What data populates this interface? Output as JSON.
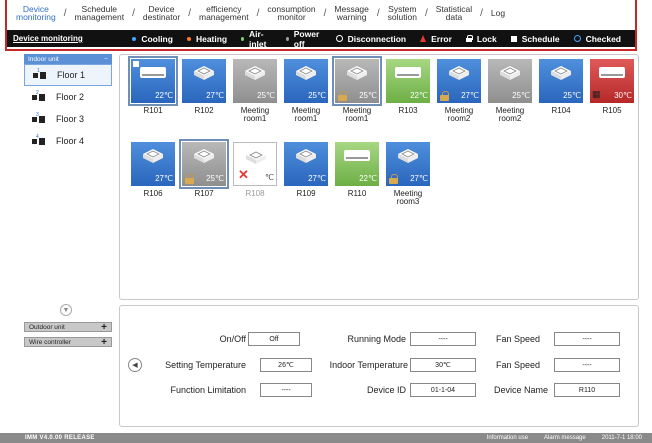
{
  "nav": {
    "items": [
      {
        "label": "Device\nmonitoring",
        "active": true
      },
      {
        "label": "Schedule\nmanagement",
        "active": false
      },
      {
        "label": "Device\ndestinator",
        "active": false
      },
      {
        "label": "efficiency\nmanagement",
        "active": false
      },
      {
        "label": "consumption\nmonitor",
        "active": false
      },
      {
        "label": "Message\nwarning",
        "active": false
      },
      {
        "label": "System\nsolution",
        "active": false
      },
      {
        "label": "Statistical\ndata",
        "active": false
      },
      {
        "label": "Log",
        "active": false
      }
    ]
  },
  "status_bar": {
    "title": "Device monitoring",
    "legend": [
      {
        "label": "Cooling",
        "marker": "dot",
        "color": "#4aa3ff"
      },
      {
        "label": "Heating",
        "marker": "dot",
        "color": "#ff7a1a"
      },
      {
        "label": "Air-inlet",
        "marker": "dot",
        "color": "#7ad36b"
      },
      {
        "label": "Power off",
        "marker": "dot",
        "color": "#9e9e9e"
      },
      {
        "label": "Disconnection",
        "marker": "ring",
        "color": "#ffffff"
      },
      {
        "label": "Error",
        "marker": "error",
        "color": "#e53935"
      },
      {
        "label": "Lock",
        "marker": "lock",
        "color": "#ffffff"
      },
      {
        "label": "Schedule",
        "marker": "square",
        "color": "#ffffff"
      },
      {
        "label": "Checked",
        "marker": "ring-blue",
        "color": "#4aa3ff"
      }
    ]
  },
  "sidebar": {
    "header": "Indoor unit",
    "header_action": "−",
    "floors": [
      {
        "label": "Floor 1",
        "num": "1",
        "active": true
      },
      {
        "label": "Floor 2",
        "num": "2",
        "active": false
      },
      {
        "label": "Floor 3",
        "num": "3",
        "active": false
      },
      {
        "label": "Floor 4",
        "num": "4",
        "active": false
      }
    ],
    "scroll_icon": "▼",
    "outdoor_unit": "Outdoor unit",
    "wire_controller": "Wire controller",
    "expand_label": "+"
  },
  "units": [
    {
      "name": "R101",
      "temp": "22℃",
      "color": "blue",
      "type": "wall",
      "lock": false,
      "schedule": true,
      "selected": true,
      "error": false
    },
    {
      "name": "R102",
      "temp": "27℃",
      "color": "blue",
      "type": "cassette",
      "lock": false,
      "schedule": false,
      "selected": false,
      "error": false
    },
    {
      "name": "Meeting\nroom1",
      "temp": "25℃",
      "color": "gray",
      "type": "cassette",
      "lock": false,
      "schedule": false,
      "selected": false,
      "error": false
    },
    {
      "name": "Meeting\nroom1",
      "temp": "25℃",
      "color": "blue",
      "type": "cassette",
      "lock": false,
      "schedule": false,
      "selected": false,
      "error": false
    },
    {
      "name": "Meeting\nroom1",
      "temp": "25℃",
      "color": "gray",
      "type": "cassette",
      "lock": true,
      "schedule": false,
      "selected": true,
      "error": false
    },
    {
      "name": "R103",
      "temp": "22℃",
      "color": "green",
      "type": "wall",
      "lock": false,
      "schedule": false,
      "selected": false,
      "error": false
    },
    {
      "name": "Meeting\nroom2",
      "temp": "27℃",
      "color": "blue",
      "type": "cassette",
      "lock": true,
      "schedule": false,
      "selected": false,
      "error": false
    },
    {
      "name": "Meeting\nroom2",
      "temp": "25℃",
      "color": "gray",
      "type": "cassette",
      "lock": false,
      "schedule": false,
      "selected": false,
      "error": false
    },
    {
      "name": "R104",
      "temp": "25℃",
      "color": "blue",
      "type": "cassette",
      "lock": false,
      "schedule": false,
      "selected": false,
      "error": false
    },
    {
      "name": "R105",
      "temp": "30℃",
      "color": "red",
      "type": "wall",
      "lock": false,
      "schedule": false,
      "selected": false,
      "error": false,
      "building": true
    },
    {
      "name": "R106",
      "temp": "27℃",
      "color": "blue",
      "type": "cassette",
      "lock": false,
      "schedule": false,
      "selected": false,
      "error": false
    },
    {
      "name": "R107",
      "temp": "25℃",
      "color": "gray",
      "type": "cassette",
      "lock": true,
      "schedule": false,
      "selected": true,
      "error": false
    },
    {
      "name": "R108",
      "temp": "℃",
      "color": "off",
      "type": "cassette",
      "lock": false,
      "schedule": false,
      "selected": false,
      "error": true
    },
    {
      "name": "R109",
      "temp": "27℃",
      "color": "blue",
      "type": "cassette",
      "lock": false,
      "schedule": false,
      "selected": false,
      "error": false
    },
    {
      "name": "R110",
      "temp": "22℃",
      "color": "green",
      "type": "wall",
      "lock": false,
      "schedule": false,
      "selected": false,
      "error": false
    },
    {
      "name": "Meeting\nroom3",
      "temp": "27℃",
      "color": "blue",
      "type": "cassette",
      "lock": true,
      "schedule": false,
      "selected": false,
      "error": false
    }
  ],
  "details": {
    "nav_icon": "◀",
    "fields": {
      "on_off": {
        "label": "On/Off",
        "value": "Off"
      },
      "running_mode": {
        "label": "Running Mode",
        "value": "----"
      },
      "fan_speed_1": {
        "label": "Fan Speed",
        "value": "----"
      },
      "setting_temp": {
        "label": "Setting Temperature",
        "value": "26℃"
      },
      "indoor_temp": {
        "label": "Indoor Temperature",
        "value": "30℃"
      },
      "fan_speed_2": {
        "label": "Fan Speed",
        "value": "----"
      },
      "function_limit": {
        "label": "Function Limitation",
        "value": "----"
      },
      "device_id": {
        "label": "Device ID",
        "value": "01-1-04"
      },
      "device_name": {
        "label": "Device Name",
        "value": "R110"
      }
    }
  },
  "bottom": {
    "version": "IMM V4.0.00 RELEASE",
    "information": "Information use",
    "alarm": "Alarm message",
    "datetime": "2011-7-1   18:00"
  }
}
